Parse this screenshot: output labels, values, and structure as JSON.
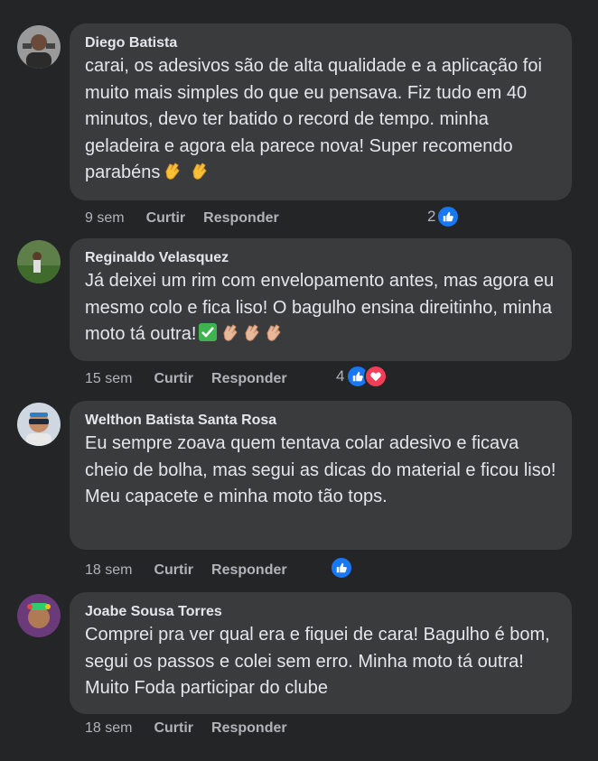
{
  "comments": [
    {
      "author": "Diego Batista",
      "text": "carai, os adesivos são de alta qualidade e a aplicação foi muito mais simples do que eu pensava. Fiz tudo em 40 minutos, devo ter batido o record de tempo. minha geladeira e agora ela parece nova! Super recomendo parabéns",
      "emojis": [
        "clapping-hands",
        "clapping-hands"
      ],
      "time": "9 sem",
      "like_label": "Curtir",
      "reply_label": "Responder",
      "reaction_count": "2",
      "reactions": [
        "like"
      ]
    },
    {
      "author": "Reginaldo Velasquez",
      "text": "Já deixei um rim com envelopamento antes, mas agora eu mesmo colo e fica liso! O bagulho ensina direitinho, minha moto tá outra!",
      "emojis": [
        "check-mark",
        "clapping-hands",
        "clapping-hands",
        "clapping-hands"
      ],
      "time": "15 sem",
      "like_label": "Curtir",
      "reply_label": "Responder",
      "reaction_count": "4",
      "reactions": [
        "like",
        "love"
      ]
    },
    {
      "author": "Welthon Batista Santa Rosa",
      "text": "Eu sempre zoava quem tentava colar adesivo e ficava cheio de bolha, mas segui as dicas do material e ficou liso! Meu capacete e minha moto tão tops.",
      "emojis": [],
      "time": "18 sem",
      "like_label": "Curtir",
      "reply_label": "Responder",
      "reaction_count": "",
      "reactions": [
        "like"
      ]
    },
    {
      "author": "Joabe Sousa Torres",
      "text": "Comprei pra ver qual era e fiquei de cara! Bagulho é bom, segui os passos e colei sem erro. Minha moto tá outra! Muito Foda participar do clube",
      "emojis": [],
      "time": "18 sem",
      "like_label": "Curtir",
      "reply_label": "Responder",
      "reaction_count": "",
      "reactions": []
    }
  ],
  "colors": {
    "background": "#242526",
    "bubble": "#3a3b3c",
    "text": "#e4e6eb",
    "secondary": "#b0b3b8",
    "like": "#1877f2",
    "love": "#f33e58"
  }
}
